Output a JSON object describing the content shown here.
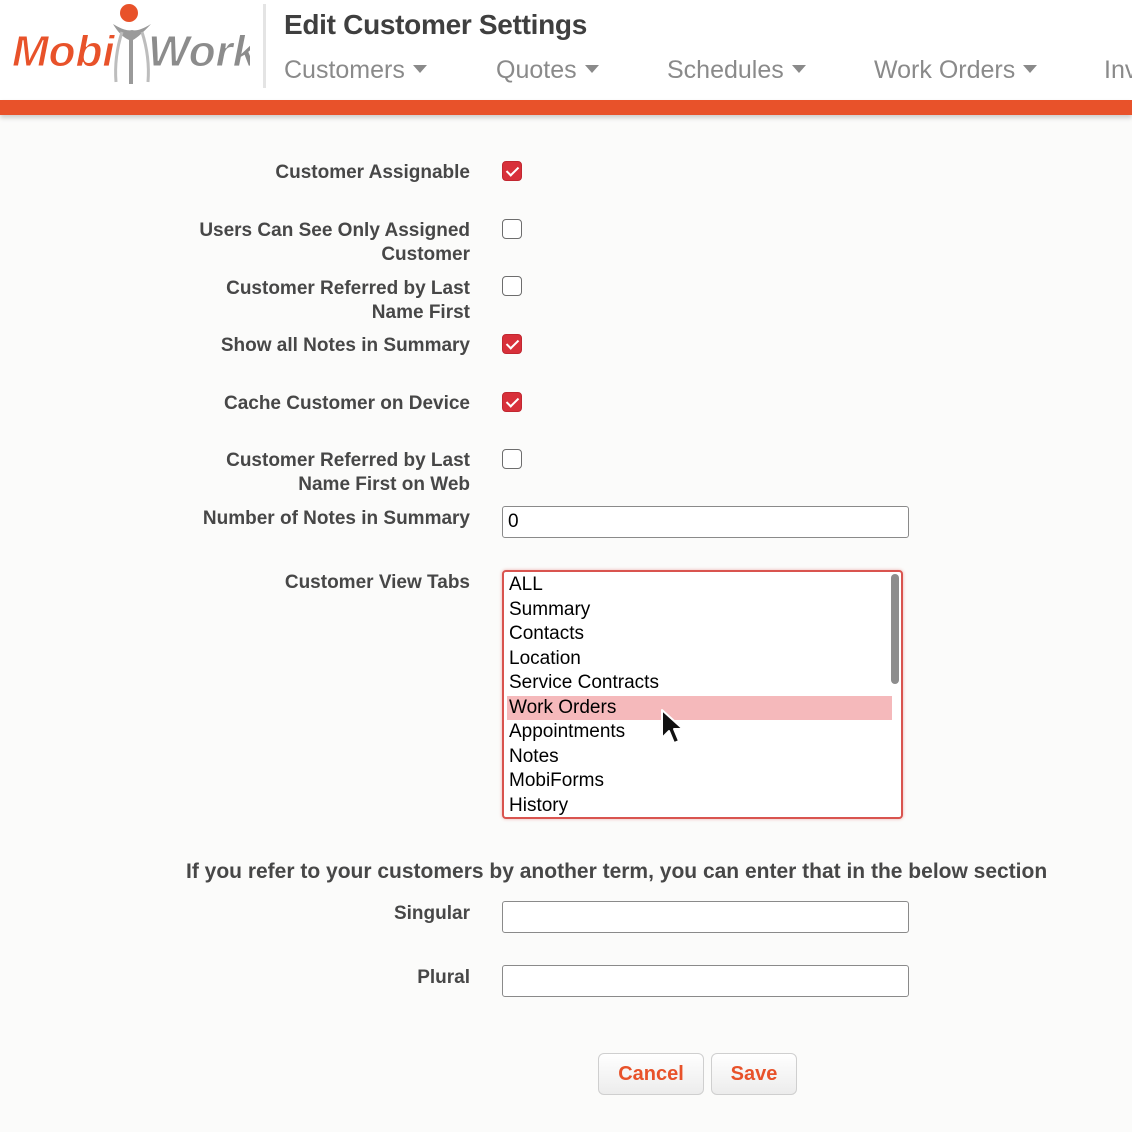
{
  "logo": {
    "text_left": "Mobi",
    "text_right": "Work",
    "brand_color": "#e8522a"
  },
  "page_title": "Edit Customer Settings",
  "nav": [
    {
      "label": "Customers"
    },
    {
      "label": "Quotes"
    },
    {
      "label": "Schedules"
    },
    {
      "label": "Work Orders"
    },
    {
      "label": "Inv"
    }
  ],
  "form": {
    "customer_assignable": {
      "label": "Customer Assignable",
      "checked": true
    },
    "users_see_assigned": {
      "label_line1": "Users Can See Only Assigned",
      "label_line2": "Customer",
      "checked": false
    },
    "referred_last_name": {
      "label_line1": "Customer Referred by Last",
      "label_line2": "Name First",
      "checked": false
    },
    "show_all_notes": {
      "label": "Show all Notes in Summary",
      "checked": true
    },
    "cache_on_device": {
      "label": "Cache Customer on Device",
      "checked": true
    },
    "referred_last_name_web": {
      "label_line1": "Customer Referred by Last",
      "label_line2": "Name First on Web",
      "checked": false
    },
    "notes_count": {
      "label": "Number of Notes in Summary",
      "value": "0"
    },
    "view_tabs": {
      "label": "Customer View Tabs",
      "options": [
        "ALL",
        "Summary",
        "Contacts",
        "Location",
        "Service Contracts",
        "Work Orders",
        "Appointments",
        "Notes",
        "MobiForms",
        "History"
      ],
      "selected": "Work Orders"
    },
    "term_note": "If you refer to your customers by another term, you can enter that in the below section",
    "singular": {
      "label": "Singular",
      "value": ""
    },
    "plural": {
      "label": "Plural",
      "value": ""
    }
  },
  "buttons": {
    "cancel": "Cancel",
    "save": "Save"
  },
  "colors": {
    "accent": "#e8522a",
    "checkbox_checked": "#d8303a",
    "selected_option": "#f5b9bb",
    "listbox_border": "#d9544f"
  }
}
